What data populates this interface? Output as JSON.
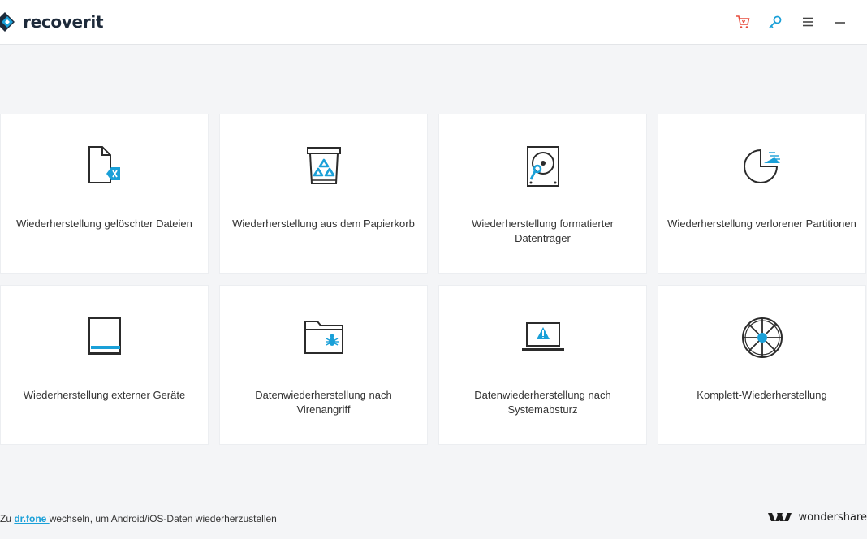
{
  "app": {
    "name": "recoverit"
  },
  "toolbar": {
    "icons": [
      "cart-icon",
      "key-icon",
      "menu-icon",
      "minimize-icon"
    ],
    "colors": {
      "cart": "#e74c3c",
      "key": "#1aa0d8",
      "neutral": "#444444"
    }
  },
  "cards": [
    {
      "label": "Wiederherstellung gelöschter Dateien",
      "icon": "deleted-file-icon"
    },
    {
      "label": "Wiederherstellung aus dem Papierkorb",
      "icon": "recycle-bin-icon"
    },
    {
      "label": "Wiederherstellung formatierter Datenträger",
      "icon": "hard-drive-icon"
    },
    {
      "label": "Wiederherstellung verlorener Partitionen",
      "icon": "partition-icon"
    },
    {
      "label": "Wiederherstellung externer Geräte",
      "icon": "external-device-icon"
    },
    {
      "label": "Datenwiederherstellung nach Virenangriff",
      "icon": "virus-folder-icon"
    },
    {
      "label": "Datenwiederherstellung nach Systemabsturz",
      "icon": "crashed-computer-icon"
    },
    {
      "label": "Komplett-Wiederherstellung",
      "icon": "all-around-icon"
    }
  ],
  "footer": {
    "prefix": "Zu ",
    "link": "dr.fone ",
    "suffix": "wechseln, um Android/iOS-Daten wiederherzustellen",
    "brand": "wondershare"
  },
  "theme": {
    "accent": "#1aa0d8",
    "dark": "#2b2b2b"
  }
}
